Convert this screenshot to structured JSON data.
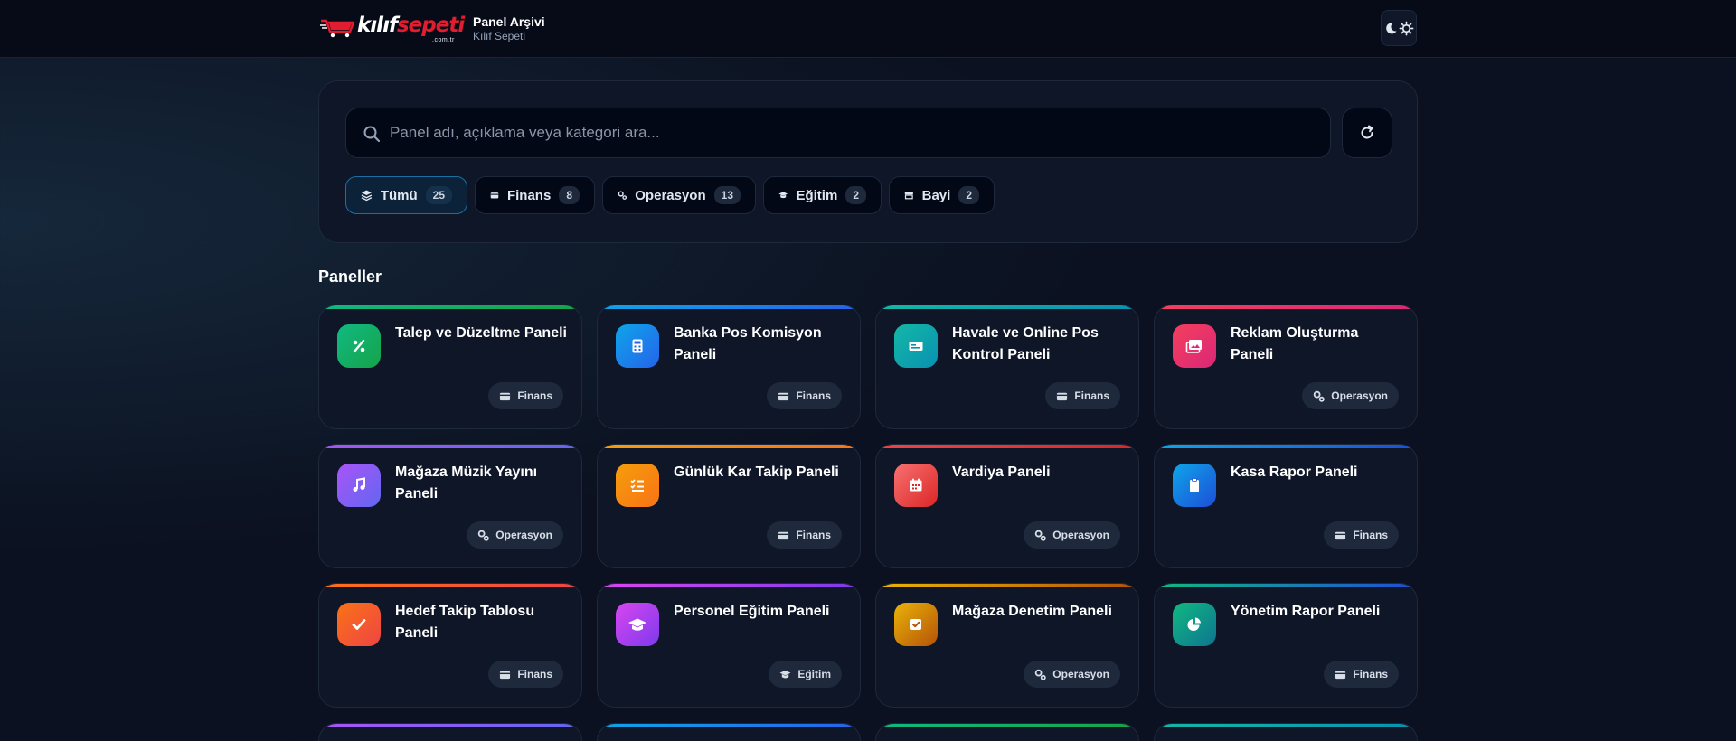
{
  "brand": {
    "logo_text_white": "kılıf",
    "logo_text_red": "sepeti",
    "logo_sub": ".com.tr",
    "title": "Panel Arşivi",
    "subtitle": "Kılıf Sepeti"
  },
  "theme_toggle": {
    "icons": [
      "moon-icon",
      "sun-icon"
    ]
  },
  "search": {
    "placeholder": "Panel adı, açıklama veya kategori ara...",
    "value": ""
  },
  "filters": [
    {
      "label": "Tümü",
      "count": "25",
      "icon": "layers-icon",
      "active": true
    },
    {
      "label": "Finans",
      "count": "8",
      "icon": "wallet-icon",
      "active": false
    },
    {
      "label": "Operasyon",
      "count": "13",
      "icon": "gears-icon",
      "active": false
    },
    {
      "label": "Eğitim",
      "count": "2",
      "icon": "graduation-cap-icon",
      "active": false
    },
    {
      "label": "Bayi",
      "count": "2",
      "icon": "store-icon",
      "active": false
    }
  ],
  "section_title": "Paneller",
  "category_labels": {
    "finans": "Finans",
    "operasyon": "Operasyon",
    "egitim": "Eğitim"
  },
  "panels": [
    {
      "title": "Talep ve Düzeltme Paneli",
      "category": "Finans",
      "icon": "percent-icon",
      "colors": [
        "#10b981",
        "#16a34a"
      ]
    },
    {
      "title": "Banka Pos Komisyon Paneli",
      "category": "Finans",
      "icon": "calculator-icon",
      "colors": [
        "#0ea5e9",
        "#2563eb"
      ]
    },
    {
      "title": "Havale ve Online Pos Kontrol Paneli",
      "category": "Finans",
      "icon": "money-bill-icon",
      "colors": [
        "#14b8a6",
        "#0891b2"
      ]
    },
    {
      "title": "Reklam Oluşturma Paneli",
      "category": "Operasyon",
      "icon": "images-icon",
      "colors": [
        "#f43f5e",
        "#db2777"
      ]
    },
    {
      "title": "Mağaza Müzik Yayını Paneli",
      "category": "Operasyon",
      "icon": "music-icon",
      "colors": [
        "#a855f7",
        "#6366f1"
      ]
    },
    {
      "title": "Günlük Kar Takip Paneli",
      "category": "Finans",
      "icon": "list-check-icon",
      "colors": [
        "#f59e0b",
        "#f97316"
      ]
    },
    {
      "title": "Vardiya Paneli",
      "category": "Operasyon",
      "icon": "calendar-icon",
      "colors": [
        "#ef4444",
        "#dc2626"
      ]
    },
    {
      "title": "Kasa Rapor Paneli",
      "category": "Finans",
      "icon": "clipboard-icon",
      "colors": [
        "#0ea5e9",
        "#1d4ed8"
      ]
    },
    {
      "title": "Hedef Takip Tablosu Paneli",
      "category": "Finans",
      "icon": "check-icon",
      "colors": [
        "#f97316",
        "#ef4444"
      ]
    },
    {
      "title": "Personel Eğitim Paneli",
      "category": "Eğitim",
      "icon": "graduation-cap-icon",
      "colors": [
        "#d946ef",
        "#7c3aed"
      ]
    },
    {
      "title": "Mağaza Denetim Paneli",
      "category": "Operasyon",
      "icon": "square-check-icon",
      "colors": [
        "#eab308",
        "#b45309"
      ]
    },
    {
      "title": "Yönetim Rapor Paneli",
      "category": "Finans",
      "icon": "chart-pie-icon",
      "colors": [
        "#10b981",
        "#1d4ed8"
      ]
    }
  ],
  "partial_row_colors": [
    [
      "#a855f7",
      "#6366f1"
    ],
    [
      "#0ea5e9",
      "#2563eb"
    ],
    [
      "#10b981",
      "#16a34a"
    ],
    [
      "#14b8a6",
      "#0891b2"
    ]
  ]
}
